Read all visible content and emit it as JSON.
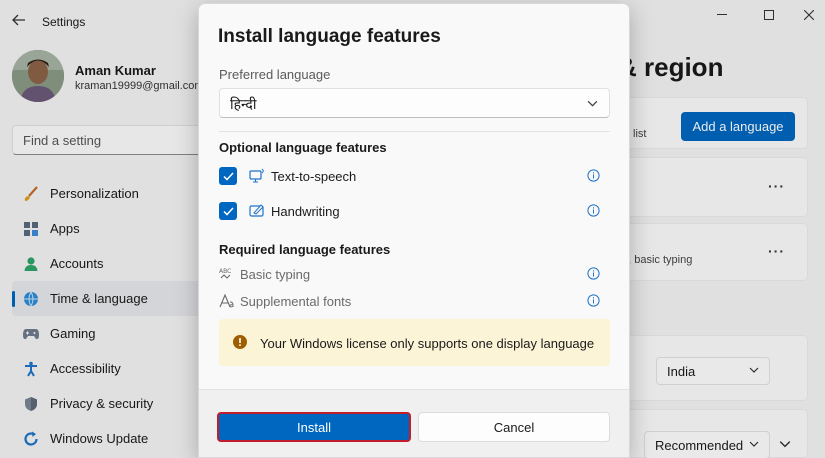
{
  "window": {
    "title": "Settings"
  },
  "profile": {
    "name": "Aman Kumar",
    "email": "kraman19999@gmail.com"
  },
  "search": {
    "placeholder": "Find a setting"
  },
  "sidebar": {
    "items": [
      {
        "label": "Personalization",
        "icon": "brush-icon"
      },
      {
        "label": "Apps",
        "icon": "apps-icon"
      },
      {
        "label": "Accounts",
        "icon": "person-icon"
      },
      {
        "label": "Time & language",
        "icon": "globe-clock-icon",
        "active": true
      },
      {
        "label": "Gaming",
        "icon": "gamepad-icon"
      },
      {
        "label": "Accessibility",
        "icon": "accessibility-icon"
      },
      {
        "label": "Privacy & security",
        "icon": "shield-icon"
      },
      {
        "label": "Windows Update",
        "icon": "update-icon"
      }
    ]
  },
  "main": {
    "heading_fragment": "& region",
    "list_fragment": "list",
    "add_language_label": "Add a language",
    "features_fragment": "g, basic typing",
    "country_value": "India",
    "format_value": "Recommended"
  },
  "dialog": {
    "title": "Install language features",
    "preferred_label": "Preferred language",
    "preferred_value": "हिन्दी",
    "optional_heading": "Optional language features",
    "optional": [
      {
        "label": "Text-to-speech",
        "checked": true
      },
      {
        "label": "Handwriting",
        "checked": true
      }
    ],
    "required_heading": "Required language features",
    "required": [
      {
        "label": "Basic typing"
      },
      {
        "label": "Supplemental fonts"
      }
    ],
    "warning_text": "Your Windows license only supports one display language",
    "install_label": "Install",
    "cancel_label": "Cancel"
  },
  "colors": {
    "accent": "#0067c0",
    "warning_bg": "#fcf4d7",
    "warning_icon": "#9d5d00",
    "highlight_border": "#c21d2c"
  }
}
